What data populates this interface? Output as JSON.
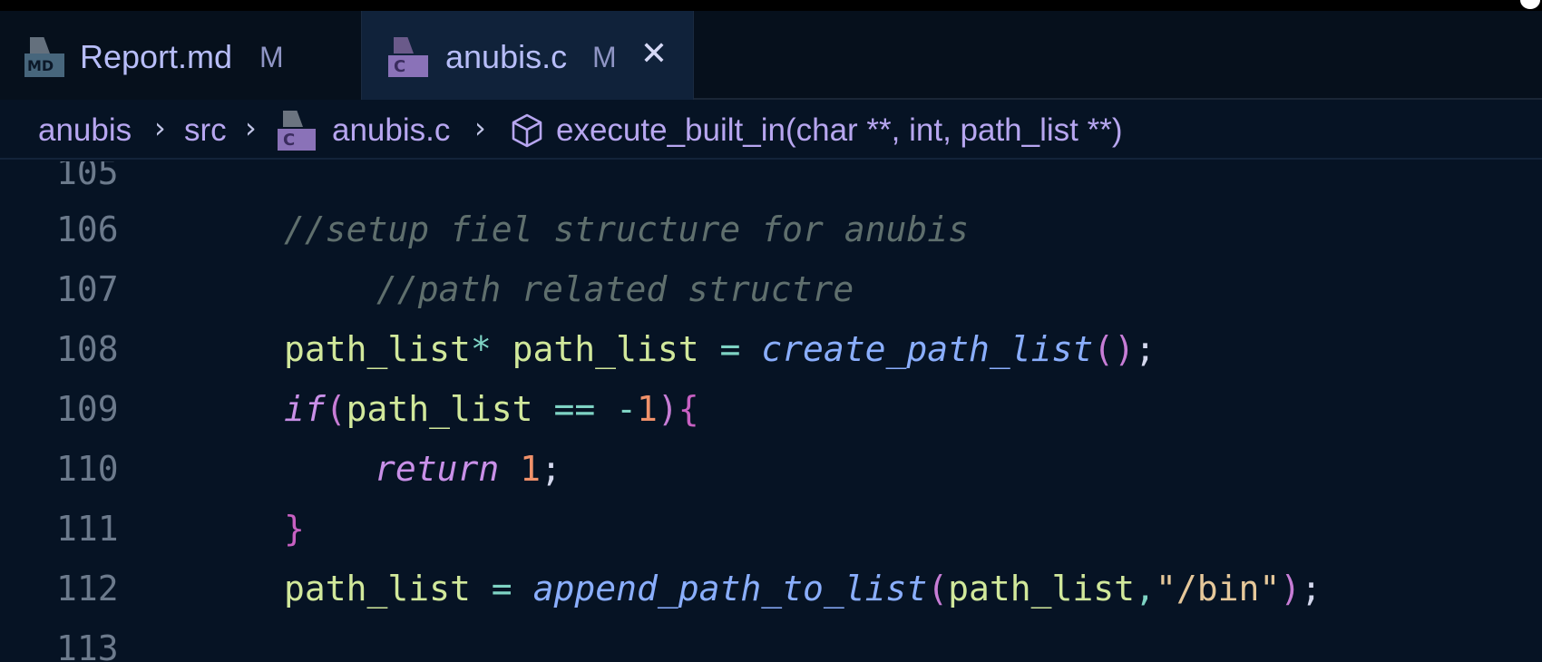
{
  "tabs": [
    {
      "icon": "markdown-file-icon",
      "icon_label": "MD",
      "name": "Report.md",
      "status": "M",
      "active": false
    },
    {
      "icon": "c-file-icon",
      "icon_label": "C",
      "name": "anubis.c",
      "status": "M",
      "active": true,
      "close": "✕"
    }
  ],
  "breadcrumbs": {
    "folder": "anubis",
    "subfolder": "src",
    "file": "anubis.c",
    "file_icon_label": "C",
    "symbol": "execute_built_in(char **, int, path_list **)",
    "separator": "›"
  },
  "editor": {
    "lines": [
      {
        "number": "105",
        "tokens": []
      },
      {
        "number": "106",
        "tokens": [
          {
            "t": "comment",
            "v": "//setup fiel structure for anubis"
          }
        ]
      },
      {
        "number": "107",
        "tokens": [
          {
            "t": "comment",
            "v": "//path related structre"
          }
        ]
      },
      {
        "number": "108",
        "tokens": [
          {
            "t": "ident",
            "v": "path_list"
          },
          {
            "t": "op",
            "v": "*"
          },
          {
            "t": "ident",
            "v": " path_list "
          },
          {
            "t": "op",
            "v": "="
          },
          {
            "t": "ident",
            "v": " "
          },
          {
            "t": "func",
            "v": "create_path_list"
          },
          {
            "t": "paren",
            "v": "()"
          },
          {
            "t": "punct",
            "v": ";"
          }
        ]
      },
      {
        "number": "109",
        "tokens": [
          {
            "t": "keyword",
            "v": "if"
          },
          {
            "t": "paren",
            "v": "("
          },
          {
            "t": "ident",
            "v": "path_list "
          },
          {
            "t": "op",
            "v": "=="
          },
          {
            "t": "ident",
            "v": " "
          },
          {
            "t": "op",
            "v": "-"
          },
          {
            "t": "num",
            "v": "1"
          },
          {
            "t": "paren",
            "v": ")"
          },
          {
            "t": "brace",
            "v": "{"
          }
        ]
      },
      {
        "number": "110",
        "tokens": [
          {
            "t": "keyword",
            "v": "return"
          },
          {
            "t": "ident",
            "v": " "
          },
          {
            "t": "num",
            "v": "1"
          },
          {
            "t": "punct",
            "v": ";"
          }
        ]
      },
      {
        "number": "111",
        "tokens": [
          {
            "t": "brace",
            "v": "}"
          }
        ]
      },
      {
        "number": "112",
        "tokens": [
          {
            "t": "ident",
            "v": "path_list "
          },
          {
            "t": "op",
            "v": "="
          },
          {
            "t": "ident",
            "v": " "
          },
          {
            "t": "func",
            "v": "append_path_to_list"
          },
          {
            "t": "paren",
            "v": "("
          },
          {
            "t": "ident",
            "v": "path_list"
          },
          {
            "t": "op",
            "v": ","
          },
          {
            "t": "string",
            "v": "\"/bin\""
          },
          {
            "t": "paren",
            "v": ")"
          },
          {
            "t": "punct",
            "v": ";"
          }
        ]
      },
      {
        "number": "113",
        "tokens": []
      }
    ]
  },
  "colors": {
    "background": "#061324",
    "tab_active": "#10223a",
    "comment": "#5f6f6d",
    "identifier": "#d1e89b",
    "function": "#8aaefd",
    "keyword": "#c990e8",
    "number": "#f0916a",
    "string": "#e6c89a"
  }
}
